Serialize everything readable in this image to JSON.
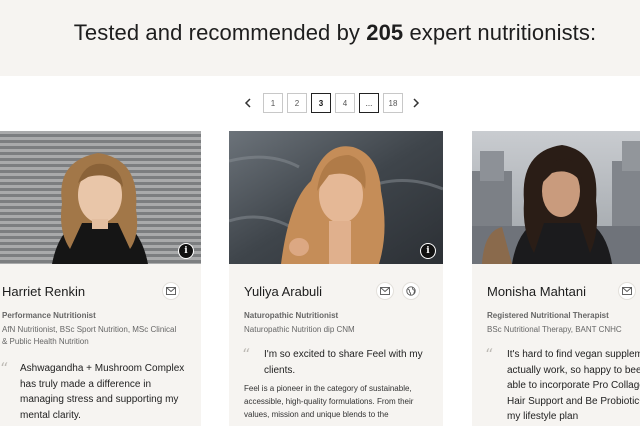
{
  "hero": {
    "prefix": "Tested and recommended by ",
    "count": "205",
    "suffix": " expert nutritionists:"
  },
  "pagination": {
    "prev_icon": "chevron-left-icon",
    "next_icon": "chevron-right-icon",
    "pages": [
      "1",
      "2",
      "3",
      "4",
      "...",
      "18"
    ],
    "active_page": "3"
  },
  "cards": [
    {
      "name": "Harriet Renkin",
      "role": "Performance Nutritionist",
      "credentials": "AfN Nutritionist, BSc Sport Nutrition, MSc Clinical & Public Health Nutrition",
      "quote": "Ashwagandha + Mushroom Complex has truly made a difference in managing stress and supporting my mental clarity.",
      "icons": [
        "mail-icon"
      ],
      "has_info_icon": true
    },
    {
      "name": "Yuliya Arabuli",
      "role": "Naturopathic Nutritionist",
      "credentials": "Naturopathic Nutrition dip CNM",
      "quote": "I'm so excited to share Feel with my clients.",
      "body": "Feel is a pioneer in the category of sustainable, accessible, high-quality formulations. From their values, mission and unique blends to the",
      "icons": [
        "mail-icon",
        "globe-icon"
      ],
      "has_info_icon": true
    },
    {
      "name": "Monisha Mahtani",
      "role": "Registered Nutritional Therapist",
      "credentials": "BSc Nutritional Therapy, BANT CNHC",
      "quote": "It's hard to find vegan supplem that actually work, so happy to been able to incorporate Pro Collagen, Hair Support and Be Probiotic+ into my lifestyle plan",
      "icons": [
        "mail-icon"
      ],
      "has_info_icon": false
    }
  ],
  "colors": {
    "card_bg": "#f6f4f1",
    "hero_bg": "#f6f4f1",
    "text": "#1e1e1e",
    "muted": "#666666"
  }
}
